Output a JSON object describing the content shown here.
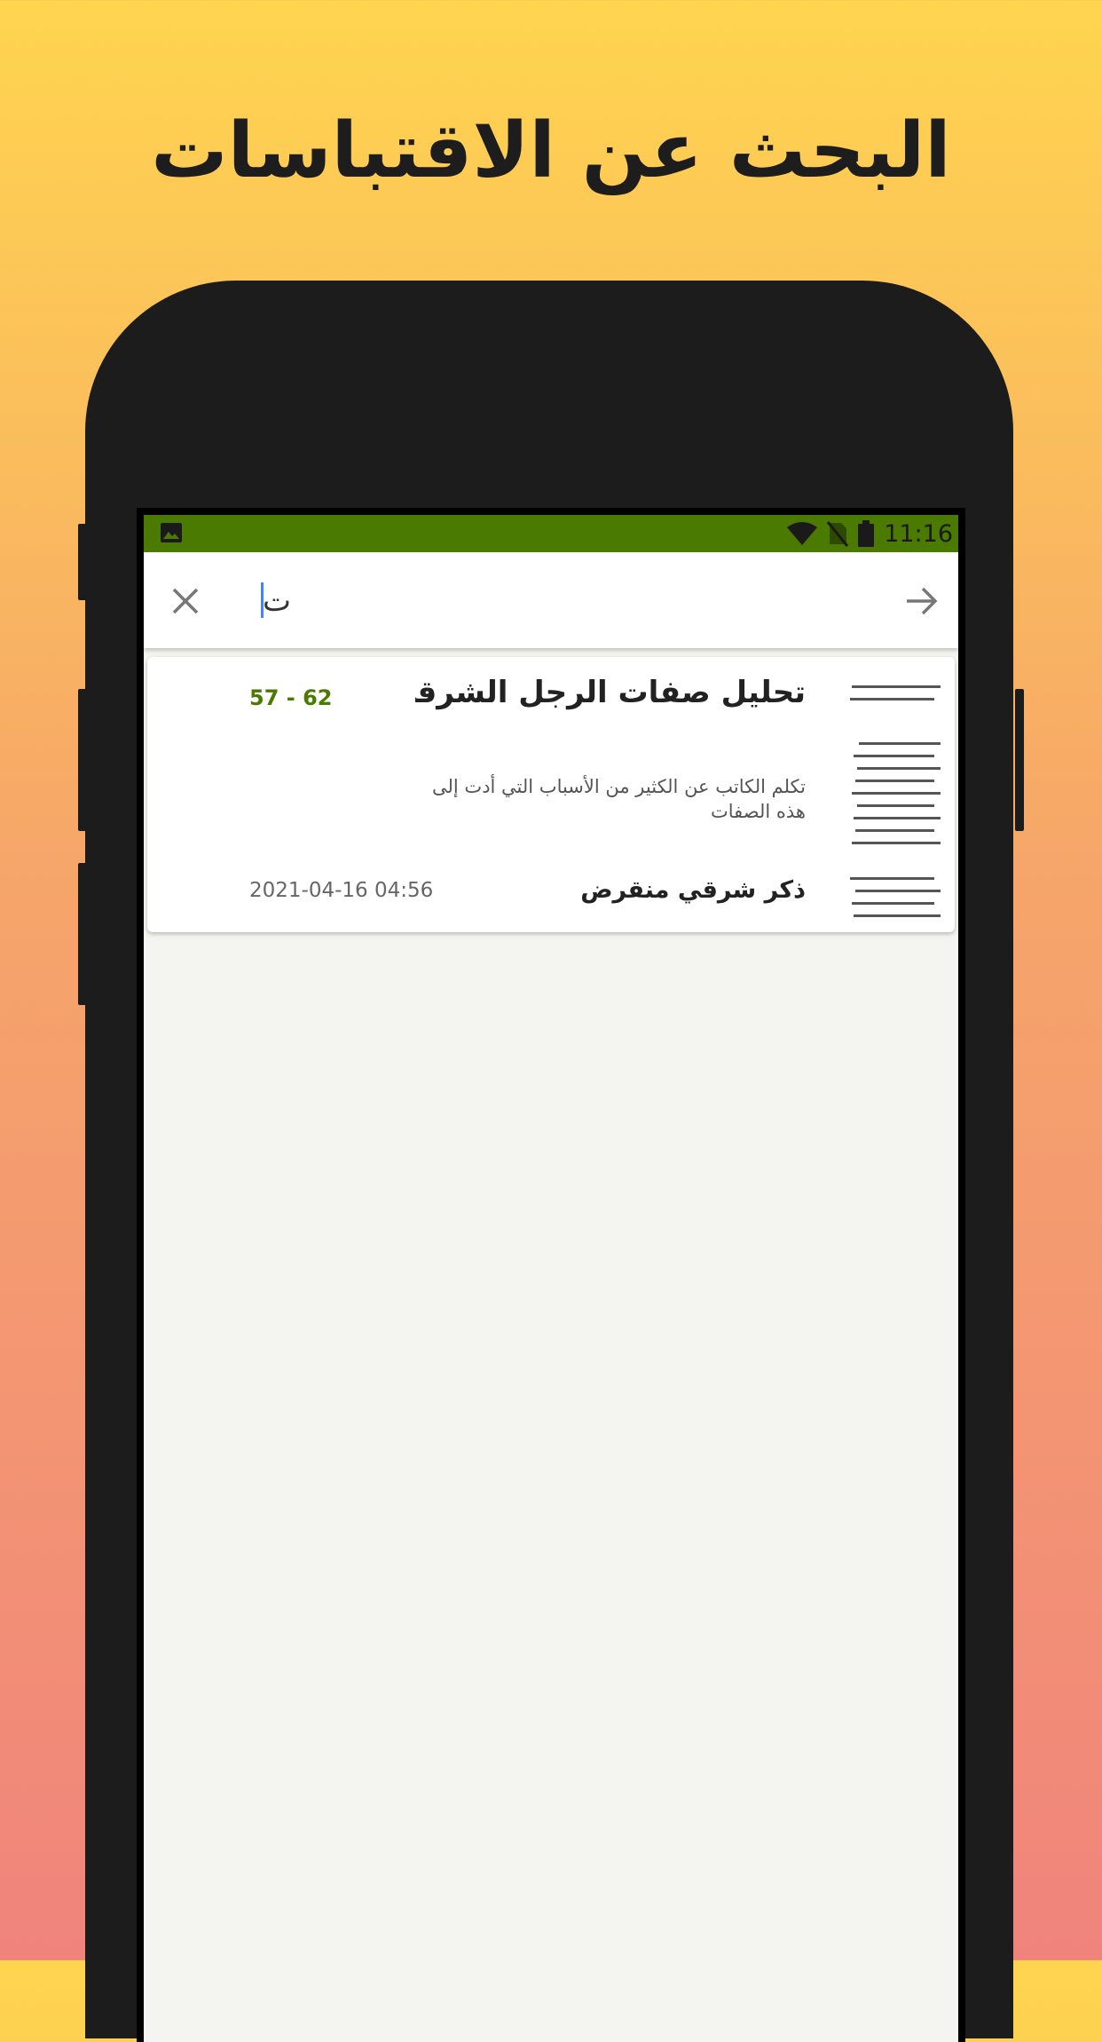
{
  "headline": "البحث عن الاقتباسات",
  "status_bar": {
    "time": "11:16",
    "icons": [
      "image-icon",
      "wifi-icon",
      "no-sim-icon",
      "battery-icon"
    ]
  },
  "search": {
    "query": "ت",
    "close_icon": "close-icon",
    "submit_icon": "arrow-right-icon"
  },
  "results": [
    {
      "title": "تحليل صفات الرجل الشرقي",
      "pages": "57 - 62",
      "description": "تكلم الكاتب عن الكثير من الأسباب التي أدت إلى هذه الصفات",
      "author": "ذكر شرقي منقرض",
      "date": "2021-04-16 04:56"
    }
  ],
  "colors": {
    "accent": "#4a7a00",
    "background_top": "#ffd54f",
    "background_bottom": "#f0847c"
  }
}
